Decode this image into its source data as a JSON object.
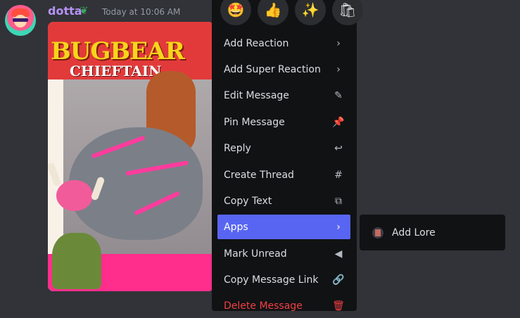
{
  "message": {
    "username": "dotta",
    "badge_icon": "leaf-badge-icon",
    "timestamp": "Today at 10:06 AM",
    "image": {
      "title_line1": "BUGBEAR",
      "title_line2": "CHIEFTAIN"
    }
  },
  "context_menu": {
    "quick_reactions": [
      {
        "emoji": "🤩",
        "icon": "star-struck-emoji-icon"
      },
      {
        "emoji": "👍",
        "icon": "thumbs-up-emoji-icon"
      },
      {
        "emoji": "✨",
        "icon": "sparkles-emoji-icon"
      },
      {
        "emoji": "🛍",
        "icon": "shopping-emoji-icon"
      }
    ],
    "items": [
      {
        "label": "Add Reaction",
        "icon": "›"
      },
      {
        "label": "Add Super Reaction",
        "icon": "›"
      },
      {
        "label": "Edit Message",
        "icon": "✎"
      },
      {
        "label": "Pin Message",
        "icon": "📌"
      },
      {
        "label": "Reply",
        "icon": "↩"
      },
      {
        "label": "Create Thread",
        "icon": "#"
      },
      {
        "label": "Copy Text",
        "icon": "⧉"
      },
      {
        "label": "Apps",
        "icon": "›"
      },
      {
        "label": "Mark Unread",
        "icon": "◀"
      },
      {
        "label": "Copy Message Link",
        "icon": "🔗"
      },
      {
        "label": "Delete Message",
        "icon": "🗑"
      }
    ]
  },
  "apps_submenu": {
    "items": [
      {
        "label": "Add Lore"
      }
    ]
  },
  "colors": {
    "background": "#313338",
    "menu_bg": "#111214",
    "accent": "#5865f2",
    "danger": "#f23f43",
    "username": "#b692f5"
  }
}
